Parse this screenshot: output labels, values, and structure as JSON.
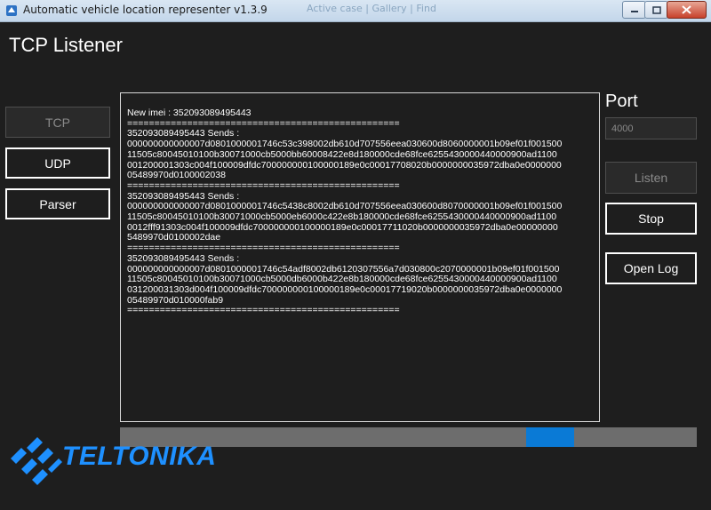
{
  "window": {
    "title": "Automatic vehicle location representer v1.3.9",
    "background_ghost": "Active case  |  Gallery  |  Find"
  },
  "page": {
    "title": "TCP Listener"
  },
  "nav": [
    {
      "label": "TCP",
      "disabled": true
    },
    {
      "label": "UDP",
      "disabled": false
    },
    {
      "label": "Parser",
      "disabled": false
    }
  ],
  "log": {
    "lines": [
      "New imei : 352093089495443",
      "==================================================",
      "352093089495443 Sends :",
      "000000000000007d0801000001746c53c398002db610d707556eea030600d8060000001b09ef01f001500",
      "11505c80045010100b30071000cb5000bb60008422e8d180000cde68fce6255430000440000900ad1100",
      "001200001303c004f100009dfdc700000000100000189e0c00017708020b0000000035972dba0e0000000",
      "05489970d0100002038",
      "==================================================",
      "352093089495443 Sends :",
      "000000000000007d0801000001746c5438c8002db610d707556eea030600d8070000001b09ef01f001500",
      "11505c80045010100b30071000cb5000eb6000c422e8b180000cde68fce6255430000440000900ad1100",
      "0012fff91303c004f100009dfdc700000000100000189e0c00017711020b0000000035972dba0e00000000",
      "5489970d0100002dae",
      "==================================================",
      "352093089495443 Sends :",
      "000000000000007d0801000001746c54adf8002db6120307556a7d030800c2070000001b09ef01f001500",
      "11505c80045010100b30071000cb5000db6000b422e8b180000cde68fce6255430000440000900ad1100",
      "031200031303d004f100009dfdc700000000100000189e0c00017719020b0000000035972dba0e0000000",
      "05489970d010000fab9",
      "=================================================="
    ]
  },
  "progress": {
    "indicator_start": 0.704,
    "indicator_width": 0.083,
    "color": "#0a7ad6"
  },
  "port": {
    "label": "Port",
    "value": "4000"
  },
  "actions": {
    "listen_label": "Listen",
    "stop_label": "Stop",
    "open_log_label": "Open Log"
  },
  "logo": {
    "text": "TELTONIKA",
    "color": "#1e90ff"
  }
}
